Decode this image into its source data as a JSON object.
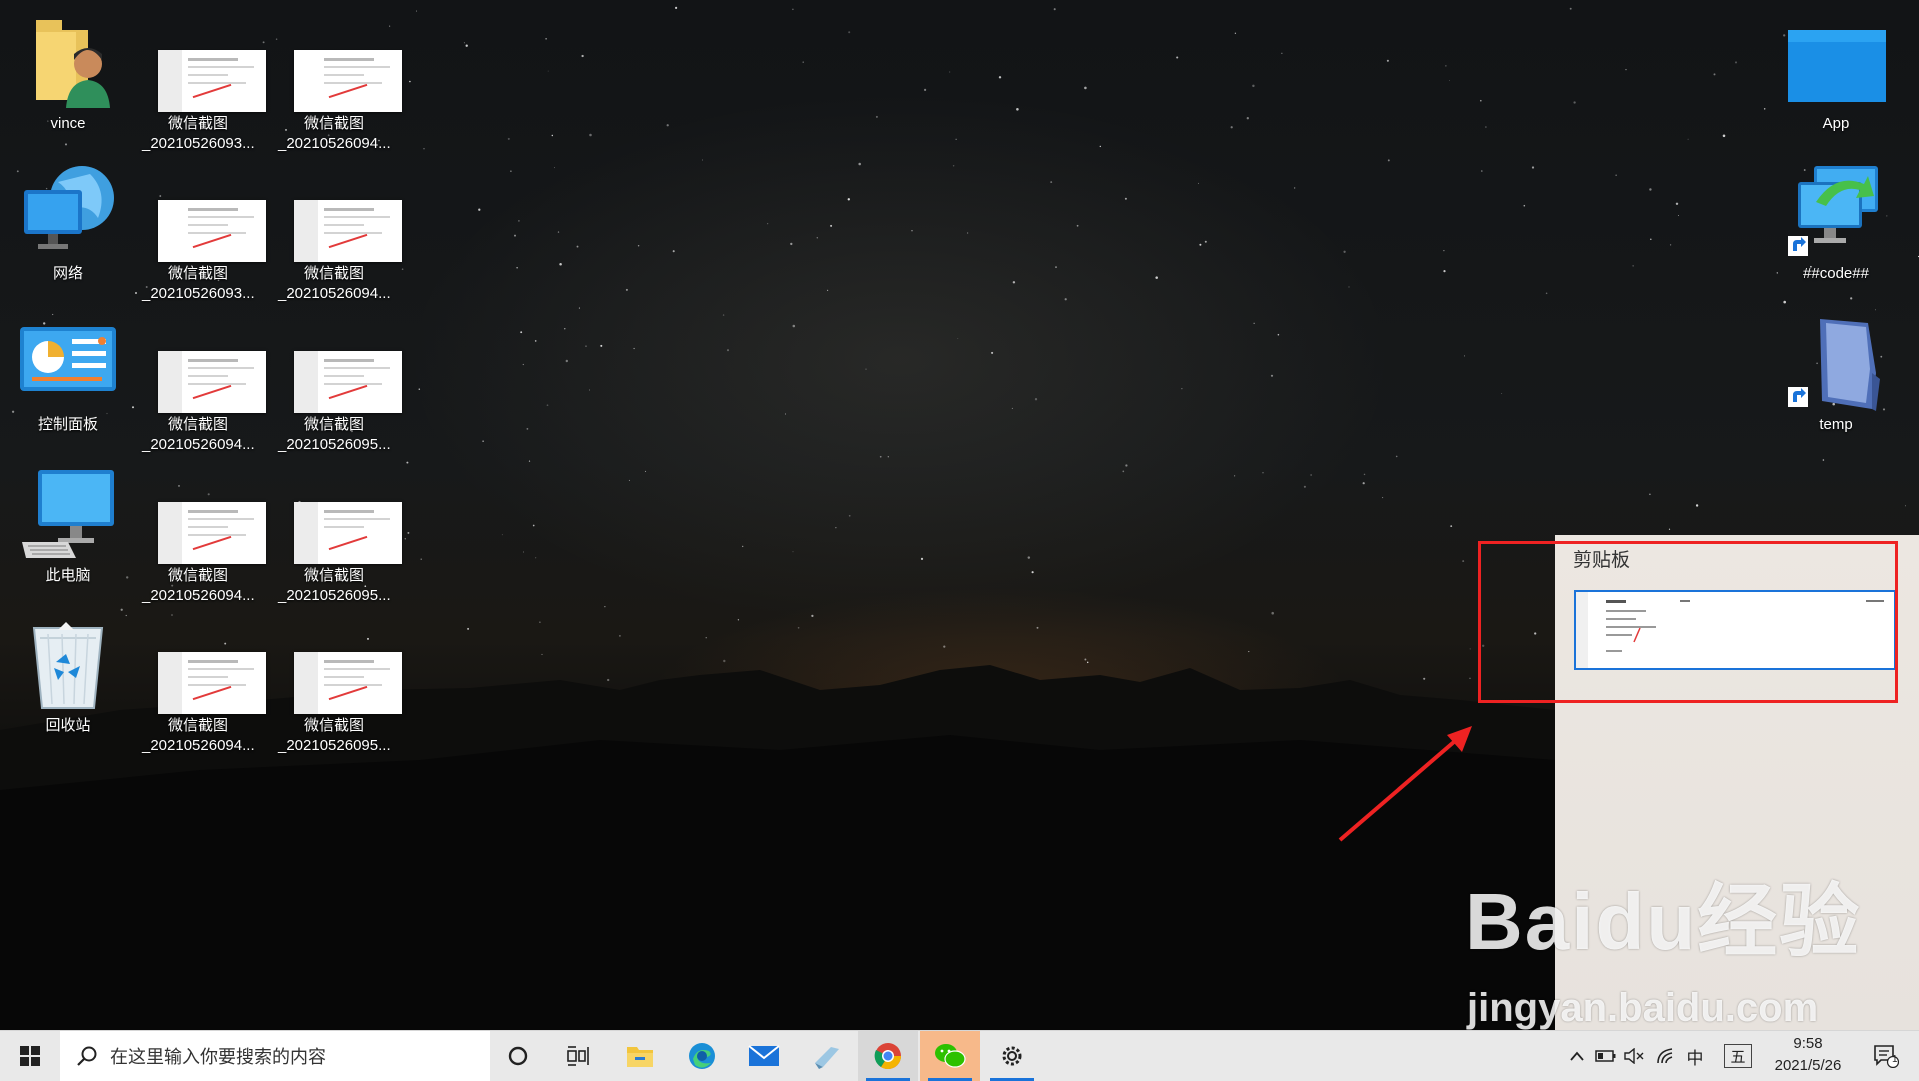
{
  "desktop_left": [
    {
      "label": "vince",
      "icon": "user-folder-icon"
    },
    {
      "label": "网络",
      "icon": "network-icon"
    },
    {
      "label": "控制面板",
      "icon": "control-panel-icon"
    },
    {
      "label": "此电脑",
      "icon": "this-pc-icon"
    },
    {
      "label": "回收站",
      "icon": "recycle-bin-icon"
    }
  ],
  "screenshots": [
    {
      "line1": "微信截图",
      "line2": "_20210526093..."
    },
    {
      "line1": "微信截图",
      "line2": "_20210526094..."
    },
    {
      "line1": "微信截图",
      "line2": "_20210526093..."
    },
    {
      "line1": "微信截图",
      "line2": "_20210526094..."
    },
    {
      "line1": "微信截图",
      "line2": "_20210526094..."
    },
    {
      "line1": "微信截图",
      "line2": "_20210526095..."
    },
    {
      "line1": "微信截图",
      "line2": "_20210526094..."
    },
    {
      "line1": "微信截图",
      "line2": "_20210526095..."
    },
    {
      "line1": "微信截图",
      "line2": "_20210526094..."
    },
    {
      "line1": "微信截图",
      "line2": "_20210526095..."
    }
  ],
  "desktop_right": [
    {
      "label": "App",
      "icon": "app-folder-icon"
    },
    {
      "label": "##code##",
      "icon": "network-shortcut-icon"
    },
    {
      "label": "temp",
      "icon": "temp-folder-shortcut-icon"
    }
  ],
  "clipboard": {
    "title": "剪贴板"
  },
  "watermark": {
    "brand": "Baidu经验",
    "url": "jingyan.baidu.com"
  },
  "taskbar": {
    "search_placeholder": "在这里输入你要搜索的内容",
    "tray_ime_lang": "中",
    "tray_ime_mode": "五",
    "time": "9:58",
    "date": "2021/5/26",
    "notification_count": "1"
  },
  "colors": {
    "accent": "#1a73d9",
    "annotation": "#ee2222"
  }
}
